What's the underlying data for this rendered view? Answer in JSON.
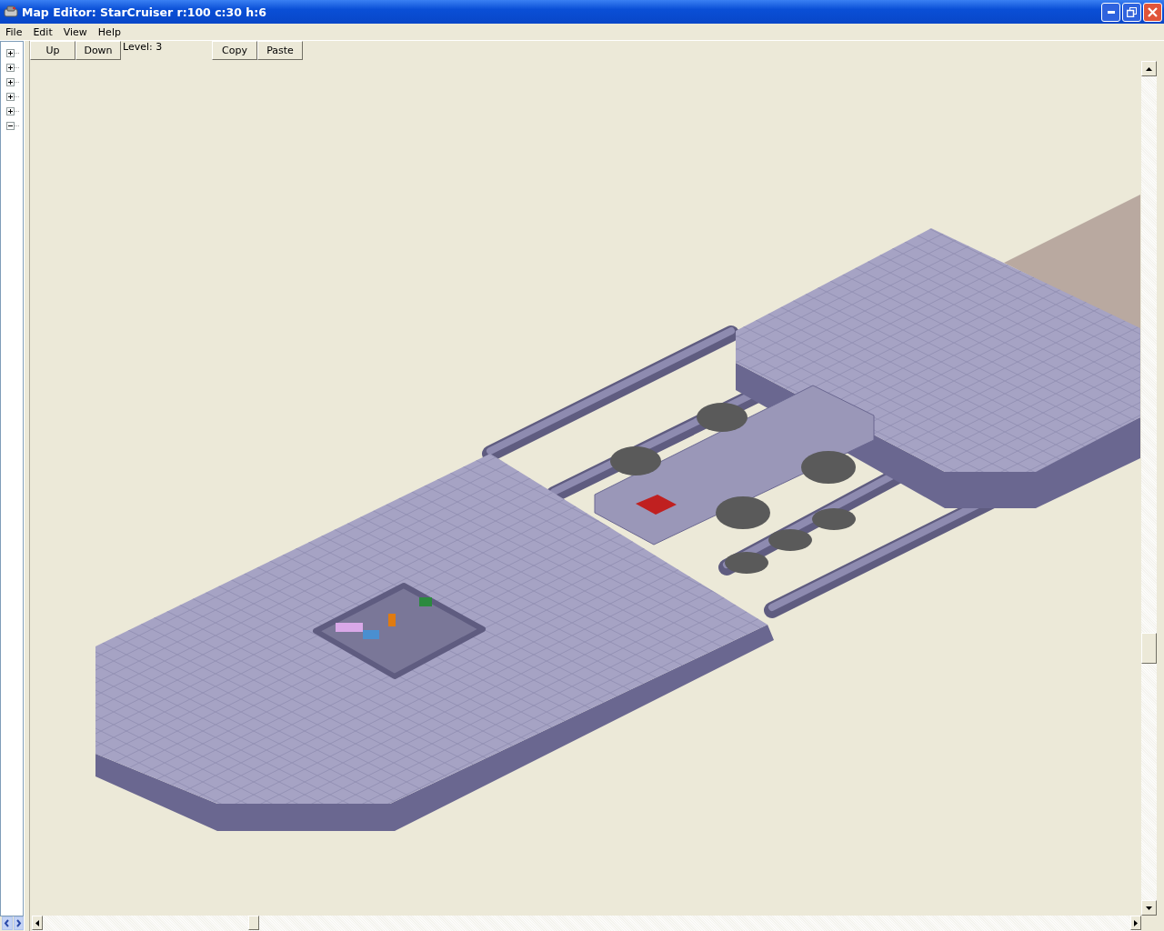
{
  "window": {
    "title": "Map Editor: StarCruiser r:100 c:30 h:6"
  },
  "menu": [
    "File",
    "Edit",
    "View",
    "Help"
  ],
  "tree": [
    {
      "expanded": false
    },
    {
      "expanded": false
    },
    {
      "expanded": false
    },
    {
      "expanded": false
    },
    {
      "expanded": false
    },
    {
      "expanded": true
    }
  ],
  "toolbar": {
    "level_buttons": [
      "Up",
      "Down"
    ],
    "level_label": "Level: 3",
    "clipboard_buttons": [
      "Copy",
      "Paste"
    ]
  }
}
